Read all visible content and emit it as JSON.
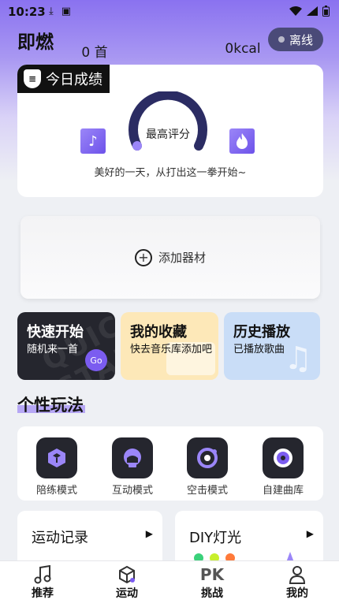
{
  "status_bar": {
    "time": "10:23"
  },
  "header": {
    "app_title": "即燃",
    "offline_label": "离线"
  },
  "today": {
    "tag_label": "今日成绩",
    "badge_glyph": "≡",
    "song_count": "0 首",
    "kcal": "0kcal",
    "best_score_label": "最高评分",
    "slogan": "美好的一天，从打出这一拳开始~"
  },
  "add_equipment": {
    "label": "添加器材"
  },
  "quick_cards": [
    {
      "title": "快速开始",
      "subtitle": "随机来一首",
      "button": "Go",
      "watermark": "QUICK START"
    },
    {
      "title": "我的收藏",
      "subtitle": "快去音乐库添加吧"
    },
    {
      "title": "历史播放",
      "subtitle": "已播放歌曲"
    }
  ],
  "section": {
    "title": "个性玩法"
  },
  "modes": [
    {
      "label": "陪练模式",
      "icon": "cube-icon"
    },
    {
      "label": "互动模式",
      "icon": "boxing-glove-icon"
    },
    {
      "label": "空击模式",
      "icon": "target-ring-icon"
    },
    {
      "label": "自建曲库",
      "icon": "disc-icon"
    }
  ],
  "bottom_cards": [
    {
      "title": "运动记录"
    },
    {
      "title": "DIY灯光"
    }
  ],
  "tabbar": [
    {
      "label": "推荐",
      "icon": "music-note-icon"
    },
    {
      "label": "运动",
      "icon": "cube-icon"
    },
    {
      "label": "挑战",
      "icon": "pk-icon",
      "glyph": "PK"
    },
    {
      "label": "我的",
      "icon": "person-icon"
    }
  ],
  "colors": {
    "accent": "#7b5cf0",
    "dark_tile": "#25262e",
    "offline_pill": "#4a4a78"
  }
}
